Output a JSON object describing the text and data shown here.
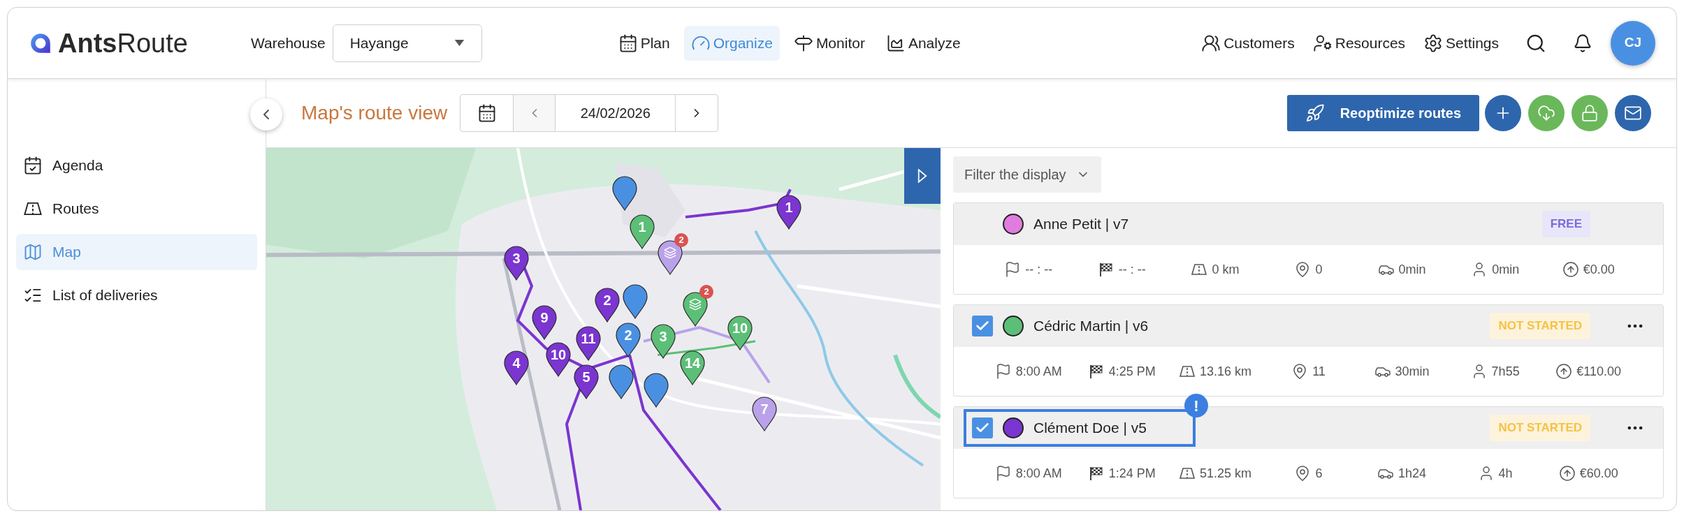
{
  "header": {
    "logo": {
      "bold": "Ants",
      "light": "Route"
    },
    "warehouse": {
      "label": "Warehouse",
      "value": "Hayange"
    },
    "nav": [
      {
        "label": "Plan",
        "selected": false
      },
      {
        "label": "Organize",
        "selected": true
      },
      {
        "label": "Monitor",
        "selected": false
      },
      {
        "label": "Analyze",
        "selected": false
      }
    ],
    "actions": [
      {
        "label": "Customers"
      },
      {
        "label": "Resources"
      },
      {
        "label": "Settings"
      }
    ],
    "avatar": "CJ"
  },
  "sidebar": {
    "items": [
      {
        "label": "Agenda",
        "selected": false
      },
      {
        "label": "Routes",
        "selected": false
      },
      {
        "label": "Map",
        "selected": true
      },
      {
        "label": "List of deliveries",
        "selected": false
      }
    ]
  },
  "toolbar": {
    "title": "Map's route view",
    "date": "24/02/2026",
    "primary": "Reoptimize routes",
    "buttons": [
      {
        "color": "#2e66ad"
      },
      {
        "color": "#6ab85a"
      },
      {
        "color": "#6ab85a"
      },
      {
        "color": "#2e66ad"
      }
    ]
  },
  "map": {
    "markers": [
      {
        "kind": "pin",
        "label": "1",
        "color": "#7b35d0"
      },
      {
        "kind": "pin",
        "color": "#4a90e2"
      },
      {
        "kind": "pin",
        "label": "1",
        "color": "#5cbf77"
      },
      {
        "kind": "cluster",
        "count": "2",
        "color": "#b9a2ea"
      },
      {
        "kind": "pin",
        "label": "3",
        "color": "#7b35d0"
      },
      {
        "kind": "pin",
        "label": "2",
        "color": "#7b35d0"
      },
      {
        "kind": "pin",
        "color": "#4a90e2"
      },
      {
        "kind": "cluster",
        "count": "2",
        "color": "#5cbf77"
      },
      {
        "kind": "pin",
        "label": "9",
        "color": "#7b35d0"
      },
      {
        "kind": "pin",
        "label": "10",
        "color": "#7b35d0"
      },
      {
        "kind": "pin",
        "label": "11",
        "color": "#7b35d0"
      },
      {
        "kind": "pin",
        "label": "4",
        "color": "#7b35d0"
      },
      {
        "kind": "pin",
        "label": "5",
        "color": "#7b35d0"
      },
      {
        "kind": "pin",
        "label": "2",
        "color": "#4a90e2"
      },
      {
        "kind": "pin",
        "label": "3",
        "color": "#5cbf77"
      },
      {
        "kind": "pin",
        "label": "10",
        "color": "#5cbf77"
      },
      {
        "kind": "pin",
        "label": "14",
        "color": "#5cbf77"
      },
      {
        "kind": "pin",
        "color": "#4a90e2"
      },
      {
        "kind": "pin",
        "color": "#4a90e2"
      },
      {
        "kind": "pin",
        "label": "7",
        "color": "#b9a2ea"
      }
    ]
  },
  "panel": {
    "filter": "Filter the display",
    "routes": [
      {
        "name": "Anne Petit | v7",
        "color": "#e07be0",
        "status": {
          "kind": "free",
          "label": "FREE"
        },
        "highlighted": false,
        "stats": [
          "-- : --",
          "-- : --",
          "0 km",
          "0",
          "0min",
          "0min",
          "€0.00"
        ]
      },
      {
        "name": "Cédric Martin | v6",
        "color": "#5cbf77",
        "checked": true,
        "status": {
          "kind": "not_started",
          "label": "NOT STARTED"
        },
        "highlighted": false,
        "stats": [
          "8:00 AM",
          "4:25 PM",
          "13.16 km",
          "11",
          "30min",
          "7h55",
          "€110.00"
        ]
      },
      {
        "name": "Clément Doe | v5",
        "color": "#7b35d0",
        "checked": true,
        "status": {
          "kind": "not_started",
          "label": "NOT STARTED"
        },
        "highlighted": true,
        "alert": "!",
        "stats": [
          "8:00 AM",
          "1:24 PM",
          "51.25 km",
          "6",
          "1h24",
          "4h",
          "€60.00"
        ]
      }
    ]
  }
}
